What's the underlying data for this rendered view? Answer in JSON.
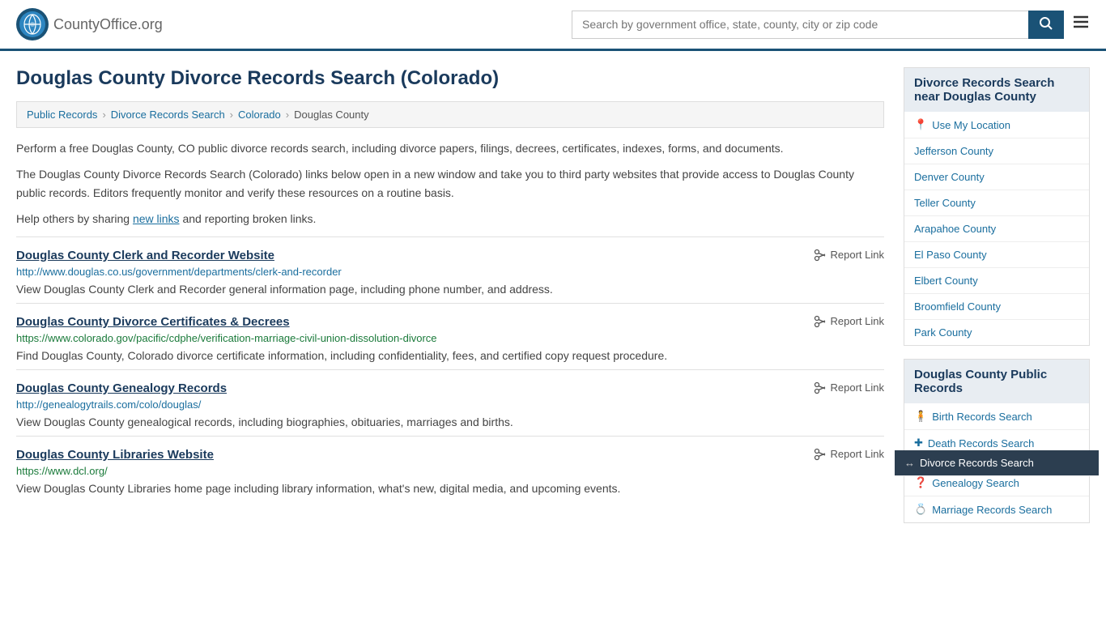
{
  "header": {
    "logo_text": "CountyOffice",
    "logo_suffix": ".org",
    "search_placeholder": "Search by government office, state, county, city or zip code"
  },
  "page": {
    "title": "Douglas County Divorce Records Search (Colorado)"
  },
  "breadcrumb": {
    "items": [
      {
        "label": "Public Records",
        "href": "#"
      },
      {
        "label": "Divorce Records Search",
        "href": "#"
      },
      {
        "label": "Colorado",
        "href": "#"
      },
      {
        "label": "Douglas County",
        "href": "#",
        "current": true
      }
    ]
  },
  "descriptions": [
    "Perform a free Douglas County, CO public divorce records search, including divorce papers, filings, decrees, certificates, indexes, forms, and documents.",
    "The Douglas County Divorce Records Search (Colorado) links below open in a new window and take you to third party websites that provide access to Douglas County public records. Editors frequently monitor and verify these resources on a routine basis.",
    "Help others by sharing new links and reporting broken links."
  ],
  "records": [
    {
      "id": "clerk-recorder",
      "title": "Douglas County Clerk and Recorder Website",
      "url": "http://www.douglas.co.us/government/departments/clerk-and-recorder",
      "url_color": "blue",
      "description": "View Douglas County Clerk and Recorder general information page, including phone number, and address."
    },
    {
      "id": "divorce-certs",
      "title": "Douglas County Divorce Certificates & Decrees",
      "url": "https://www.colorado.gov/pacific/cdphe/verification-marriage-civil-union-dissolution-divorce",
      "url_color": "green",
      "description": "Find Douglas County, Colorado divorce certificate information, including confidentiality, fees, and certified copy request procedure."
    },
    {
      "id": "genealogy",
      "title": "Douglas County Genealogy Records",
      "url": "http://genealogytrails.com/colo/douglas/",
      "url_color": "blue",
      "description": "View Douglas County genealogical records, including biographies, obituaries, marriages and births."
    },
    {
      "id": "libraries",
      "title": "Douglas County Libraries Website",
      "url": "https://www.dcl.org/",
      "url_color": "green",
      "description": "View Douglas County Libraries home page including library information, what's new, digital media, and upcoming events."
    }
  ],
  "report_link_label": "Report Link",
  "sidebar": {
    "nearby_header": "Divorce Records Search near Douglas County",
    "use_my_location": "Use My Location",
    "nearby_counties": [
      {
        "label": "Jefferson County"
      },
      {
        "label": "Denver County"
      },
      {
        "label": "Teller County"
      },
      {
        "label": "Arapahoe County"
      },
      {
        "label": "El Paso County"
      },
      {
        "label": "Elbert County"
      },
      {
        "label": "Broomfield County"
      },
      {
        "label": "Park County"
      }
    ],
    "public_records_header": "Douglas County Public Records",
    "public_records": [
      {
        "label": "Birth Records Search",
        "icon": "person"
      },
      {
        "label": "Death Records Search",
        "icon": "cross"
      },
      {
        "label": "Divorce Records Search",
        "icon": "arrow",
        "active": true
      },
      {
        "label": "Genealogy Search",
        "icon": "question"
      },
      {
        "label": "Marriage Records Search",
        "icon": "ring"
      }
    ]
  }
}
